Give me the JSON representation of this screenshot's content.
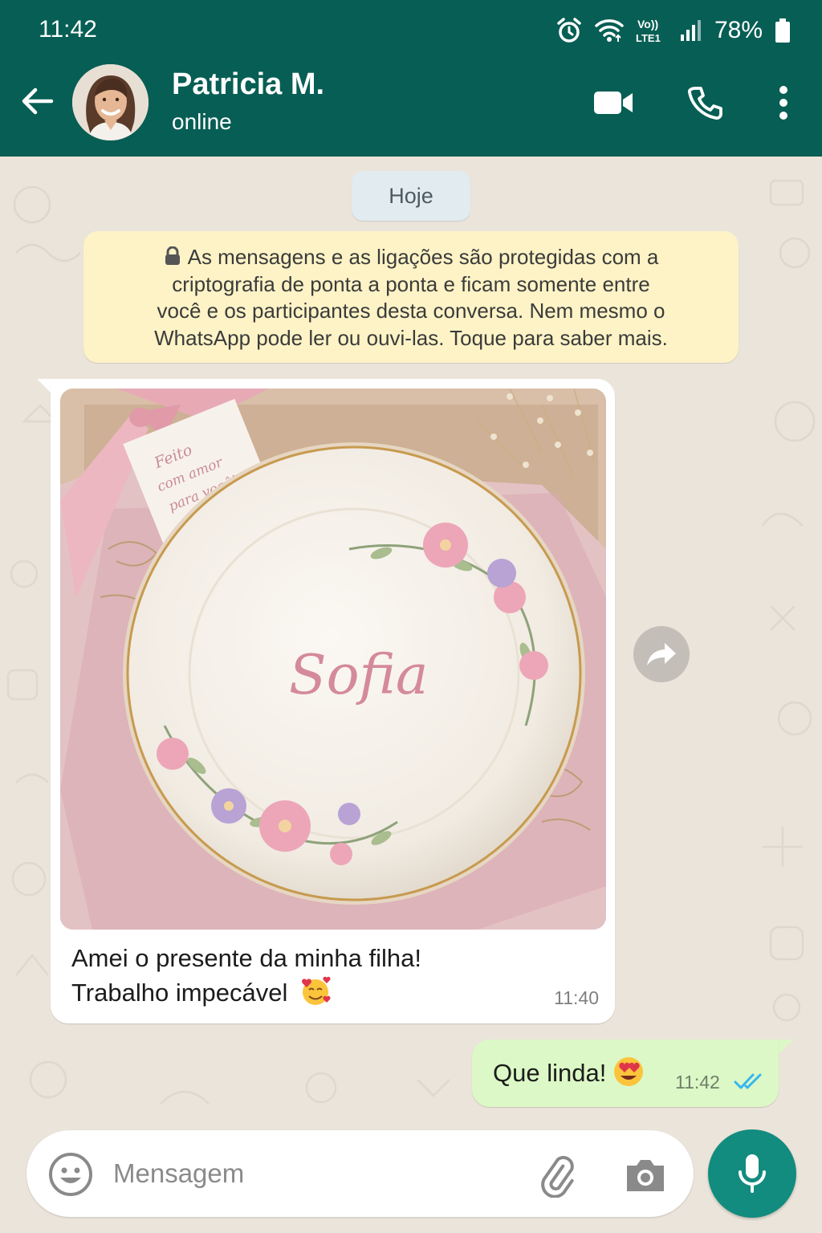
{
  "status_bar": {
    "time": "11:42",
    "network": "Vo)) LTE1",
    "battery": "78%"
  },
  "header": {
    "contact_name": "Patricia M.",
    "contact_status": "online"
  },
  "chat": {
    "date_chip": "Hoje",
    "e2e_notice": {
      "lines": [
        "As mensagens e as ligações são protegidas com a",
        "criptografia de ponta a ponta e ficam somente entre",
        "você e os participantes desta conversa. Nem mesmo o",
        "WhatsApp pode ler ou ouvi-las. Toque para saber mais."
      ]
    },
    "incoming": {
      "photo": {
        "tag_lines": [
          "Feito",
          "com amor",
          "para você!"
        ],
        "plate_name": "Sofia"
      },
      "caption_lines": [
        "Amei o presente da minha filha!",
        "Trabalho impecável"
      ],
      "emoji": "smiling-face-with-hearts",
      "time": "11:40"
    },
    "outgoing": {
      "text": "Que linda!",
      "emoji": "heart-eyes",
      "time": "11:42",
      "status": "read"
    }
  },
  "composer": {
    "placeholder": "Mensagem"
  },
  "colors": {
    "header": "#075e54",
    "chat_background": "#ebe4da",
    "outgoing_bubble": "#dcf8c6",
    "incoming_bubble": "#ffffff",
    "notice_bubble": "#fdf3c6",
    "mic_button": "#128c7e",
    "read_ticks": "#34b7f1"
  }
}
